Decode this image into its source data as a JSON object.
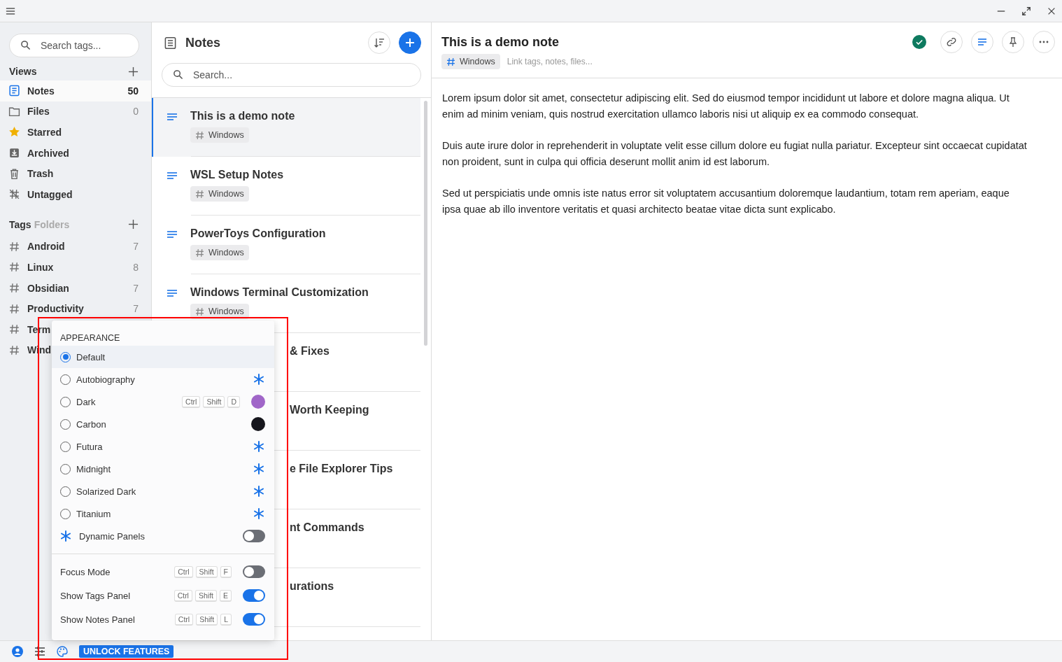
{
  "sidebar": {
    "search": {
      "placeholder": "Search tags..."
    },
    "views_title": "Views",
    "views": [
      {
        "kind": "notes",
        "label": "Notes",
        "count": "50",
        "selected": true
      },
      {
        "kind": "files",
        "label": "Files",
        "count": "0",
        "selected": false
      },
      {
        "kind": "starred",
        "label": "Starred",
        "selected": false
      },
      {
        "kind": "archived",
        "label": "Archived",
        "selected": false
      },
      {
        "kind": "trash",
        "label": "Trash",
        "selected": false
      },
      {
        "kind": "untagged",
        "label": "Untagged",
        "selected": false
      }
    ],
    "tags_title": "Tags",
    "folders_tab": "Folders",
    "tags": [
      {
        "label": "Android",
        "count": "7"
      },
      {
        "label": "Linux",
        "count": "8"
      },
      {
        "label": "Obsidian",
        "count": "7"
      },
      {
        "label": "Productivity",
        "count": "7"
      },
      {
        "label": "Term"
      },
      {
        "label": "Wind"
      }
    ]
  },
  "notes_panel": {
    "title": "Notes",
    "search": {
      "placeholder": "Search..."
    },
    "notes": [
      {
        "title": "This is a demo note",
        "tag": "Windows",
        "selected": true
      },
      {
        "title": "WSL Setup Notes",
        "tag": "Windows",
        "selected": false
      },
      {
        "title": "PowerToys Configuration",
        "tag": "Windows",
        "selected": false
      },
      {
        "title": "Windows Terminal Customization",
        "tag": "Windows",
        "selected": false
      },
      {
        "title": "& Fixes",
        "covered": true,
        "selected": false
      },
      {
        "title": "Worth Keeping",
        "covered": true,
        "selected": false
      },
      {
        "title": "e File Explorer Tips",
        "covered": true,
        "selected": false
      },
      {
        "title": "nt Commands",
        "covered": true,
        "selected": false
      },
      {
        "title": "urations",
        "covered": true,
        "selected": false
      }
    ]
  },
  "editor": {
    "title": "This is a demo note",
    "saved": true,
    "tag": "Windows",
    "link_placeholder": "Link tags, notes, files...",
    "paragraphs": [
      "Lorem ipsum dolor sit amet, consectetur adipiscing elit. Sed do eiusmod tempor incididunt ut labore et dolore magna aliqua. Ut enim ad minim veniam, quis nostrud exercitation ullamco laboris nisi ut aliquip ex ea commodo consequat.",
      "Duis aute irure dolor in reprehenderit in voluptate velit esse cillum dolore eu fugiat nulla pariatur. Excepteur sint occaecat cupidatat non proident, sunt in culpa qui officia deserunt mollit anim id est laborum.",
      "Sed ut perspiciatis unde omnis iste natus error sit voluptatem accusantium doloremque laudantium, totam rem aperiam, eaque ipsa quae ab illo inventore veritatis et quasi architecto beatae vitae dicta sunt explicabo."
    ]
  },
  "appearance_menu": {
    "heading": "APPEARANCE",
    "themes": [
      {
        "label": "Default",
        "selected": true
      },
      {
        "label": "Autobiography",
        "selected": false,
        "kind": "premium"
      },
      {
        "label": "Dark",
        "selected": false,
        "kind": "swatch",
        "color": "#a066c8",
        "keys": [
          "Ctrl",
          "Shift",
          "D"
        ]
      },
      {
        "label": "Carbon",
        "selected": false,
        "kind": "swatch",
        "color": "#16161d"
      },
      {
        "label": "Futura",
        "selected": false,
        "kind": "premium"
      },
      {
        "label": "Midnight",
        "selected": false,
        "kind": "premium"
      },
      {
        "label": "Solarized Dark",
        "selected": false,
        "kind": "premium"
      },
      {
        "label": "Titanium",
        "selected": false,
        "kind": "premium"
      }
    ],
    "dynamic_panels": {
      "label": "Dynamic Panels",
      "on": false
    },
    "toggles": [
      {
        "label": "Focus Mode",
        "keys": [
          "Ctrl",
          "Shift",
          "F"
        ],
        "on": false
      },
      {
        "label": "Show Tags Panel",
        "keys": [
          "Ctrl",
          "Shift",
          "E"
        ],
        "on": true
      },
      {
        "label": "Show Notes Panel",
        "keys": [
          "Ctrl",
          "Shift",
          "L"
        ],
        "on": true
      }
    ]
  },
  "footer": {
    "unlock_button": "UNLOCK FEATURES"
  }
}
